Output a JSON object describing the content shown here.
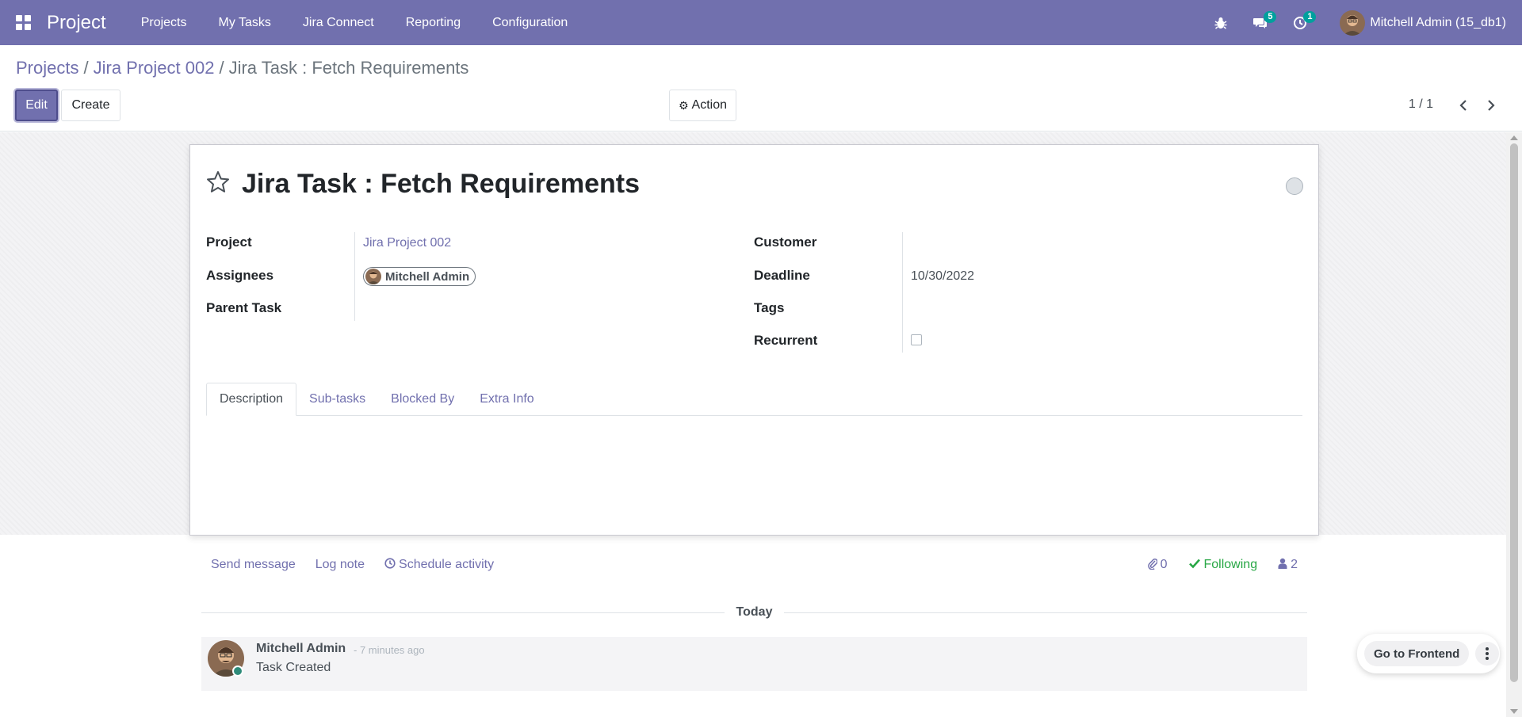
{
  "app": {
    "name": "Project",
    "menu": [
      "Projects",
      "My Tasks",
      "Jira Connect",
      "Reporting",
      "Configuration"
    ],
    "messages_count": "5",
    "activities_count": "1",
    "user": "Mitchell Admin (15_db1)"
  },
  "breadcrumb": {
    "items": [
      "Projects",
      "Jira Project 002"
    ],
    "current": "Jira Task : Fetch Requirements"
  },
  "toolbar": {
    "edit_label": "Edit",
    "create_label": "Create",
    "action_label": "Action",
    "pager": "1 / 1"
  },
  "task": {
    "title": "Jira Task : Fetch Requirements",
    "fields": {
      "project_label": "Project",
      "project_value": "Jira Project 002",
      "assignees_label": "Assignees",
      "assignee_value": "Mitchell Admin",
      "parent_label": "Parent Task",
      "customer_label": "Customer",
      "deadline_label": "Deadline",
      "deadline_value": "10/30/2022",
      "tags_label": "Tags",
      "recurrent_label": "Recurrent",
      "recurrent_checked": false
    },
    "tabs": [
      "Description",
      "Sub-tasks",
      "Blocked By",
      "Extra Info"
    ],
    "active_tab": "Description"
  },
  "chatter": {
    "send_message": "Send message",
    "log_note": "Log note",
    "schedule_activity": "Schedule activity",
    "attachments": "0",
    "following": "Following",
    "followers": "2",
    "date_separator": "Today",
    "message": {
      "author": "Mitchell Admin",
      "time": "- 7 minutes ago",
      "body": "Task Created"
    }
  },
  "floating": {
    "frontend_label": "Go to Frontend"
  },
  "colors": {
    "brand": "#7170ae",
    "following": "#28a745",
    "badge": "#00a09d"
  }
}
